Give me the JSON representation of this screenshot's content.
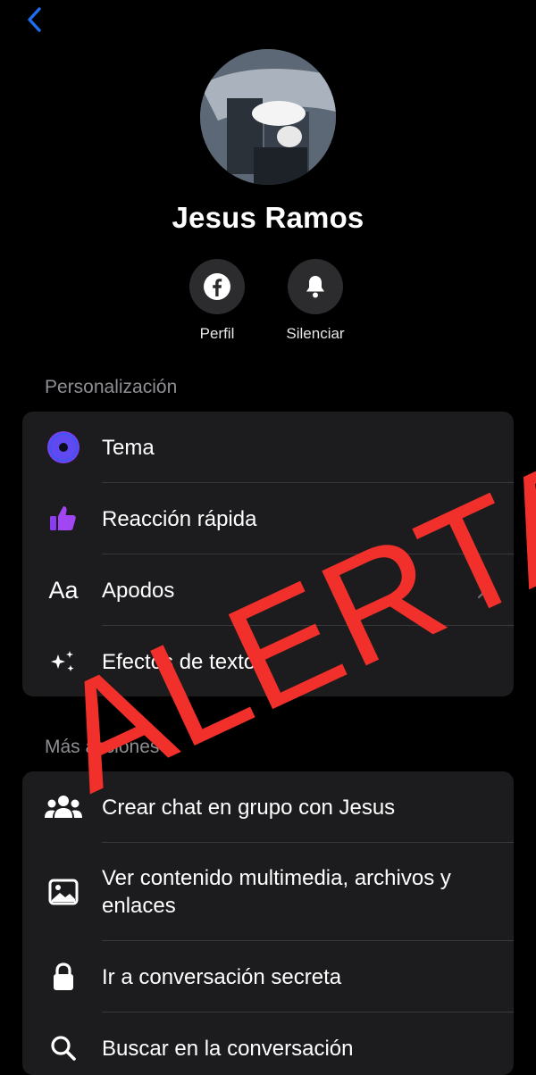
{
  "profile": {
    "name": "Jesus Ramos"
  },
  "actions": [
    {
      "label": "Perfil",
      "icon": "facebook-icon"
    },
    {
      "label": "Silenciar",
      "icon": "bell-icon"
    }
  ],
  "sections": {
    "personalization": {
      "title": "Personalización",
      "items": [
        {
          "label": "Tema",
          "icon": "theme-icon"
        },
        {
          "label": "Reacción rápida",
          "icon": "thumbs-up-icon"
        },
        {
          "label": "Apodos",
          "icon": "aa-icon",
          "icon_text": "Aa"
        },
        {
          "label": "Efectos de texto",
          "icon": "sparkles-icon"
        }
      ]
    },
    "more_actions": {
      "title": "Más acciones",
      "items": [
        {
          "label": "Crear chat en grupo con Jesus",
          "icon": "group-icon"
        },
        {
          "label": "Ver contenido multimedia, archivos y enlaces",
          "icon": "image-icon"
        },
        {
          "label": "Ir a conversación secreta",
          "icon": "lock-icon"
        },
        {
          "label": "Buscar en la conversación",
          "icon": "search-icon"
        }
      ]
    }
  },
  "overlay": {
    "text": "ALERTA",
    "color": "#f2302b"
  },
  "colors": {
    "accent": "#1e6ef0",
    "theme_purple": "#7b3ff2"
  }
}
